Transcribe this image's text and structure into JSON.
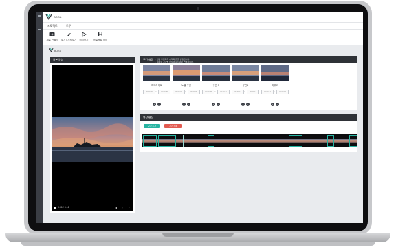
{
  "app": {
    "brand": "BORA",
    "tabs": [
      "프로젝트",
      "도구"
    ],
    "content_brand": "BORA"
  },
  "ribbon": [
    {
      "label": "새로 만들기",
      "icon": "new-project-icon"
    },
    {
      "label": "열기 / 가져오기",
      "icon": "open-file-icon"
    },
    {
      "label": "미리보기",
      "icon": "play-icon"
    },
    {
      "label": "프로젝트 저장",
      "icon": "save-icon"
    }
  ],
  "video_panel": {
    "title": "원본 영상",
    "time": "0:01 / 0:16"
  },
  "highlight_panel": {
    "title": "구간 설정",
    "notes": [
      "· 편집 구간마다 시작과 끝을 설정합니다.",
      "· 설정된 구간별 영상이 순서대로 연결됩니다."
    ],
    "clips": [
      {
        "label": "하이라이트",
        "start": "00:00:00",
        "end": "00:00:05"
      },
      {
        "label": "노을 구간",
        "start": "00:00:05",
        "end": "00:00:08"
      },
      {
        "label": "구간 3",
        "start": "00:00:08",
        "end": "00:00:11"
      },
      {
        "label": "구간4",
        "start": "00:00:11",
        "end": "00:00:14"
      },
      {
        "label": "마무리",
        "start": "00:00:14",
        "end": "00:00:16"
      }
    ]
  },
  "timeline_panel": {
    "title": "영상 편집",
    "add_button": "구간 추가",
    "delete_button": "구간 삭제"
  },
  "colors": {
    "accent_green": "#27b3a1",
    "accent_red": "#e25a50",
    "header_dark": "#2f3237"
  }
}
